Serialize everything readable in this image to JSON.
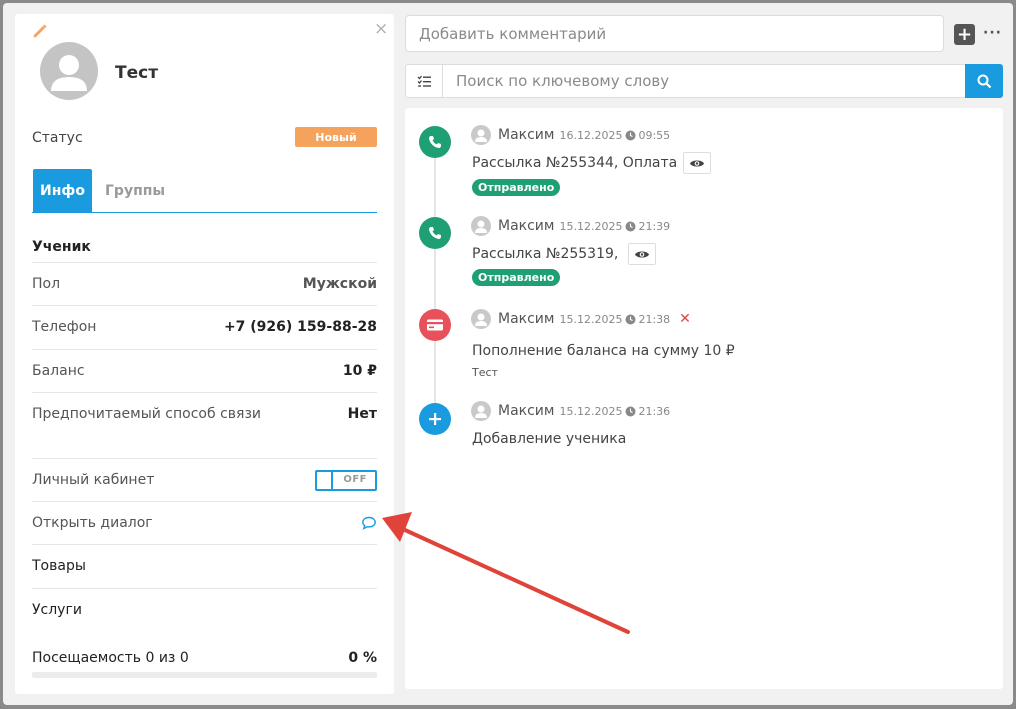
{
  "contact": {
    "name": "Тест",
    "status_label": "Статус",
    "status_value": "Новый",
    "close_glyph": "×"
  },
  "tabs": [
    {
      "label": "Инфо",
      "active": true
    },
    {
      "label": "Группы",
      "active": false
    }
  ],
  "info": {
    "section_title": "Ученик",
    "rows": [
      {
        "label": "Пол",
        "value": "Мужской"
      },
      {
        "label": "Телефон",
        "value": "+7 (926) 159-88-28"
      },
      {
        "label": "Баланс",
        "value": "10 ₽"
      },
      {
        "label": "Предпочитаемый способ связи",
        "value": "Нет"
      }
    ],
    "cabinet_label": "Личный кабинет",
    "cabinet_toggle": "OFF",
    "dialog_label": "Открыть диалог",
    "goods_label": "Товары",
    "services_label": "Услуги",
    "attendance_label": "Посещаемость 0 из 0",
    "attendance_value": "0 %"
  },
  "toolbar": {
    "comment_placeholder": "Добавить комментарий",
    "plus_glyph": "+",
    "more_glyph": "···",
    "search_placeholder": "Поиск по ключевому слову"
  },
  "events": [
    {
      "type": "call",
      "icon": "phone-icon",
      "color": "#1f9f74",
      "author": "Максим",
      "date": "16.12.2025",
      "time": "09:55",
      "text": "Рассылка №255344, Оплата",
      "badge": "Отправлено"
    },
    {
      "type": "call",
      "icon": "phone-icon",
      "color": "#1f9f74",
      "author": "Максим",
      "date": "15.12.2025",
      "time": "21:39",
      "text": "Рассылка №255319,",
      "badge": "Отправлено"
    },
    {
      "type": "payment",
      "icon": "credit-card-icon",
      "color": "#e8505b",
      "author": "Максим",
      "date": "15.12.2025",
      "time": "21:38",
      "delete_glyph": "✕",
      "text": "Пополнение баланса на сумму 10 ₽",
      "sub": "Тест"
    },
    {
      "type": "add",
      "icon": "plus-icon",
      "color": "#1a9be0",
      "author": "Максим",
      "date": "15.12.2025",
      "time": "21:36",
      "text": "Добавление ученика"
    }
  ],
  "colors": {
    "accent": "#1a9be0",
    "status_new": "#f5a25d",
    "sent_badge": "#1f9f74",
    "annotation_arrow": "#e0433a"
  }
}
